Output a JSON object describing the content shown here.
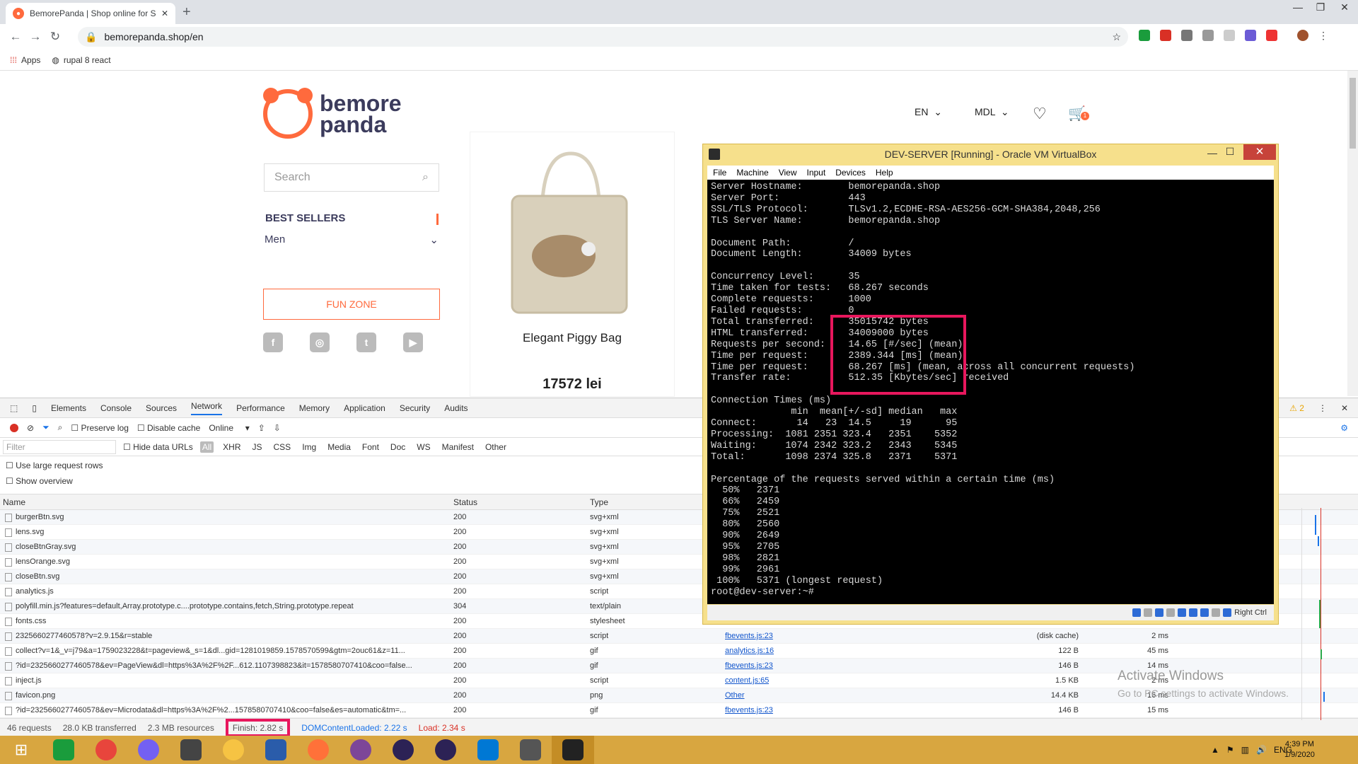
{
  "browser": {
    "tab_title": "BemorePanda | Shop online for S",
    "url": "bemorepanda.shop/en",
    "bookmarks": [
      "Apps",
      "rupal 8 react"
    ]
  },
  "page": {
    "logo_top": "bemore",
    "logo_bottom": "panda",
    "search_placeholder": "Search",
    "best_sellers": "BEST SELLERS",
    "men": "Men",
    "fun_zone": "FUN ZONE",
    "product_name": "Elegant Piggy Bag",
    "product_price": "17572 lei",
    "lang": "EN",
    "currency": "MDL",
    "cart_count": "1"
  },
  "devtools": {
    "tabs": [
      "Elements",
      "Console",
      "Sources",
      "Network",
      "Performance",
      "Memory",
      "Application",
      "Security",
      "Audits"
    ],
    "warnings": "2",
    "preserve_log": "Preserve log",
    "disable_cache": "Disable cache",
    "throttle": "Online",
    "filter_placeholder": "Filter",
    "hide_data_urls": "Hide data URLs",
    "filter_types": [
      "All",
      "XHR",
      "JS",
      "CSS",
      "Img",
      "Media",
      "Font",
      "Doc",
      "WS",
      "Manifest",
      "Other"
    ],
    "opt_large_rows": "Use large request rows",
    "opt_overview": "Show overview",
    "columns": {
      "name": "Name",
      "status": "Status",
      "type": "Type"
    },
    "rows": [
      {
        "name": "burgerBtn.svg",
        "status": "200",
        "type": "svg+xml",
        "initiator": "",
        "size": "",
        "time": ""
      },
      {
        "name": "lens.svg",
        "status": "200",
        "type": "svg+xml",
        "initiator": "",
        "size": "",
        "time": ""
      },
      {
        "name": "closeBtnGray.svg",
        "status": "200",
        "type": "svg+xml",
        "initiator": "",
        "size": "",
        "time": ""
      },
      {
        "name": "lensOrange.svg",
        "status": "200",
        "type": "svg+xml",
        "initiator": "",
        "size": "",
        "time": ""
      },
      {
        "name": "closeBtn.svg",
        "status": "200",
        "type": "svg+xml",
        "initiator": "",
        "size": "",
        "time": ""
      },
      {
        "name": "analytics.js",
        "status": "200",
        "type": "script",
        "initiator": "",
        "size": "",
        "time": ""
      },
      {
        "name": "polyfill.min.js?features=default,Array.prototype.c....prototype.contains,fetch,String.prototype.repeat",
        "status": "304",
        "type": "text/plain",
        "initiator": "",
        "size": "",
        "time": ""
      },
      {
        "name": "fonts.css",
        "status": "200",
        "type": "stylesheet",
        "initiator": "",
        "size": "",
        "time": ""
      },
      {
        "name": "2325660277460578?v=2.9.15&r=stable",
        "status": "200",
        "type": "script",
        "initiator": "fbevents.js:23",
        "size": "(disk cache)",
        "time": "2 ms"
      },
      {
        "name": "collect?v=1&_v=j79&a=1759023228&t=pageview&_s=1&dl...gid=1281019859.1578570599&gtm=2ouc61&z=11...",
        "status": "200",
        "type": "gif",
        "initiator": "analytics.js:16",
        "size": "122 B",
        "time": "45 ms"
      },
      {
        "name": "?id=2325660277460578&ev=PageView&dl=https%3A%2F%2F...612.1107398823&it=1578580707410&coo=false...",
        "status": "200",
        "type": "gif",
        "initiator": "fbevents.js:23",
        "size": "146 B",
        "time": "14 ms"
      },
      {
        "name": "inject.js",
        "status": "200",
        "type": "script",
        "initiator": "content.js:65",
        "size": "1.5 KB",
        "time": "2 ms"
      },
      {
        "name": "favicon.png",
        "status": "200",
        "type": "png",
        "initiator": "Other",
        "size": "14.4 KB",
        "time": "16 ms"
      },
      {
        "name": "?id=2325660277460578&ev=Microdata&dl=https%3A%2F%2...1578580707410&coo=false&es=automatic&tm=...",
        "status": "200",
        "type": "gif",
        "initiator": "fbevents.js:23",
        "size": "146 B",
        "time": "15 ms"
      }
    ],
    "status": {
      "requests": "46 requests",
      "transferred": "28.0 KB transferred",
      "resources": "2.3 MB resources",
      "finish": "Finish: 2.82 s",
      "dcl": "DOMContentLoaded: 2.22 s",
      "load": "Load: 2.34 s"
    }
  },
  "vbox": {
    "title": "DEV-SERVER [Running] - Oracle VM VirtualBox",
    "menu": [
      "File",
      "Machine",
      "View",
      "Input",
      "Devices",
      "Help"
    ],
    "right_ctrl": "Right Ctrl",
    "terminal": "Server Hostname:        bemorepanda.shop\nServer Port:            443\nSSL/TLS Protocol:       TLSv1.2,ECDHE-RSA-AES256-GCM-SHA384,2048,256\nTLS Server Name:        bemorepanda.shop\n\nDocument Path:          /\nDocument Length:        34009 bytes\n\nConcurrency Level:      35\nTime taken for tests:   68.267 seconds\nComplete requests:      1000\nFailed requests:        0\nTotal transferred:      35015742 bytes\nHTML transferred:       34009000 bytes\nRequests per second:    14.65 [#/sec] (mean)\nTime per request:       2389.344 [ms] (mean)\nTime per request:       68.267 [ms] (mean, across all concurrent requests)\nTransfer rate:          512.35 [Kbytes/sec] received\n\nConnection Times (ms)\n              min  mean[+/-sd] median   max\nConnect:       14   23  14.5     19      95\nProcessing:  1081 2351 323.4   2351    5352\nWaiting:     1074 2342 323.2   2343    5345\nTotal:       1098 2374 325.8   2371    5371\n\nPercentage of the requests served within a certain time (ms)\n  50%   2371\n  66%   2459\n  75%   2521\n  80%   2560\n  90%   2649\n  95%   2705\n  98%   2821\n  99%   2961\n 100%   5371 (longest request)\nroot@dev-server:~#"
  },
  "activate": {
    "line1": "Activate Windows",
    "line2": "Go to PC settings to activate Windows."
  },
  "taskbar": {
    "lang": "ENG",
    "time": "4:39 PM",
    "date": "1/9/2020"
  },
  "colors": {
    "brand": "#ff6a3d",
    "highlight": "#e8175d",
    "taskbar": "#d8a640"
  }
}
